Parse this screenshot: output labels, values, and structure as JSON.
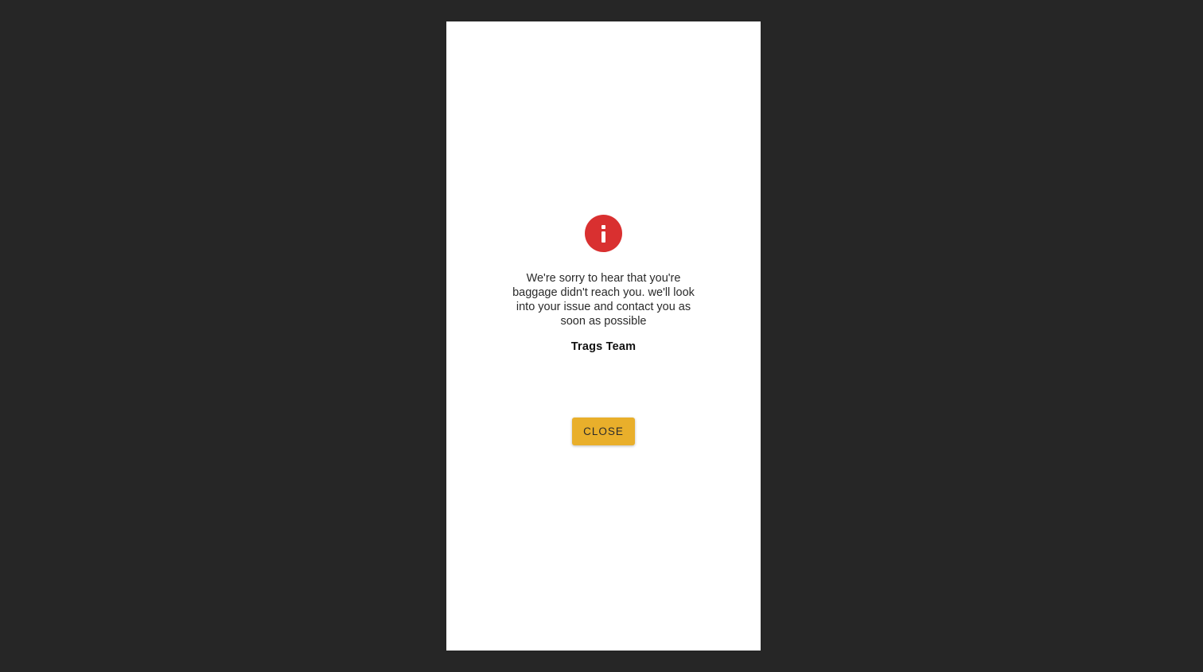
{
  "dialog": {
    "icon": "info-icon",
    "icon_color": "#d93030",
    "message": "We're sorry to hear that you're baggage didn't reach you. we'll look into your issue and contact you as soon as possible",
    "signature": "Trags Team",
    "close_label": "CLOSE",
    "button_color": "#e9af2b"
  }
}
